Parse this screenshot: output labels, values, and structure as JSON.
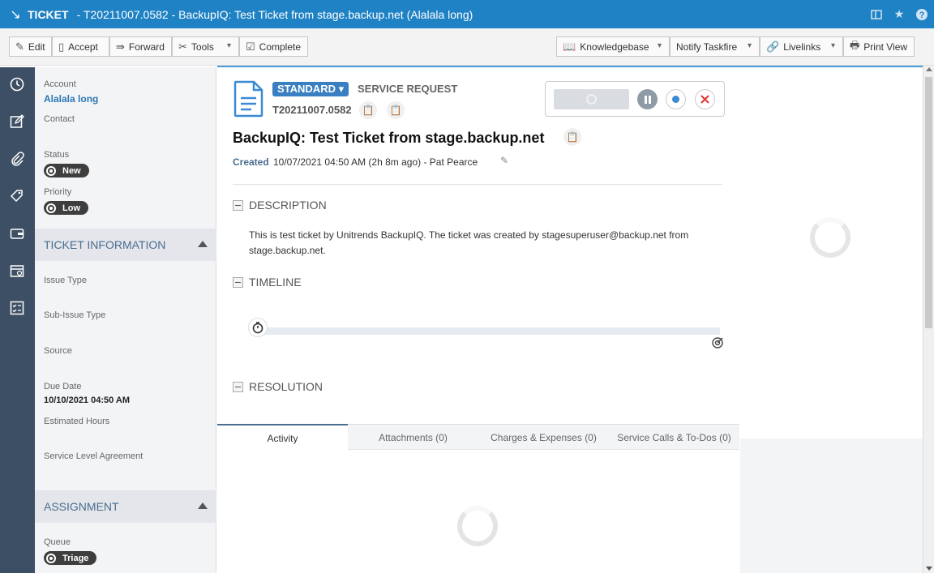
{
  "window": {
    "label": "TICKET",
    "title": "- T20211007.0582 - BackupIQ: Test Ticket from stage.backup.net (Alalala long)"
  },
  "toolbar": {
    "edit": "Edit",
    "accept": "Accept",
    "forward": "Forward",
    "tools": "Tools",
    "complete": "Complete",
    "knowledgebase": "Knowledgebase",
    "notify": "Notify Taskfire",
    "livelinks": "Livelinks",
    "print": "Print View"
  },
  "left": {
    "account_label": "Account",
    "account_value": "Alalala long",
    "contact_label": "Contact",
    "status_label": "Status",
    "status_value": "New",
    "priority_label": "Priority",
    "priority_value": "Low",
    "ticket_info_header": "TICKET INFORMATION",
    "issue_type_label": "Issue Type",
    "sub_issue_type_label": "Sub-Issue Type",
    "source_label": "Source",
    "due_date_label": "Due Date",
    "due_date_value": "10/10/2021 04:50 AM",
    "estimated_hours_label": "Estimated Hours",
    "sla_label": "Service Level Agreement",
    "assignment_header": "ASSIGNMENT",
    "queue_label": "Queue",
    "queue_value": "Triage"
  },
  "ticket": {
    "category": "STANDARD ▾",
    "type": "SERVICE REQUEST",
    "number": "T20211007.0582",
    "title": "BackupIQ: Test Ticket from stage.backup.net",
    "created_label": "Created",
    "created_value": "10/07/2021 04:50 AM (2h 8m ago) - Pat Pearce"
  },
  "sections": {
    "description": "DESCRIPTION",
    "description_text": "This is test ticket by Unitrends BackupIQ. The ticket was created by stagesuperuser@backup.net from stage.backup.net.",
    "timeline": "TIMELINE",
    "resolution": "RESOLUTION"
  },
  "tabs": {
    "activity": "Activity",
    "attachments": "Attachments (0)",
    "charges": "Charges & Expenses (0)",
    "service_calls": "Service Calls & To-Dos (0)"
  },
  "colors": {
    "titlebar": "#1f82c4",
    "rail": "#3d4f65",
    "accent": "#3a7fc1",
    "stop": "#e03b3b"
  }
}
